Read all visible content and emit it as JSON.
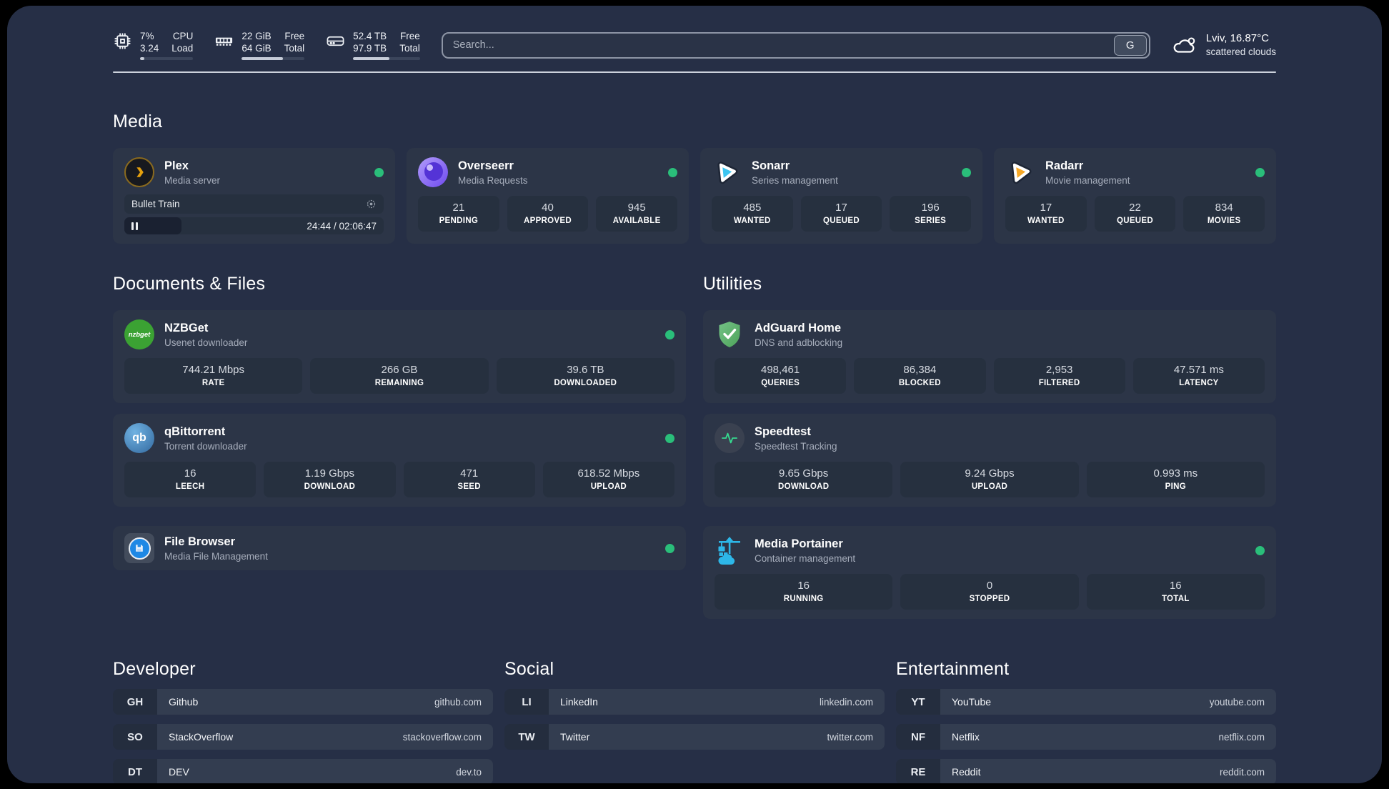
{
  "page": {
    "panel_bg": "#262f46",
    "card_bg": "#2c3547",
    "tile_bg": "#26303f",
    "accent_green": "#2abe7a"
  },
  "header": {
    "cpu": {
      "values": [
        "7%",
        "3.24"
      ],
      "labels": [
        "CPU",
        "Load"
      ],
      "progress_pct": 8
    },
    "memory": {
      "values": [
        "22 GiB",
        "64 GiB"
      ],
      "labels": [
        "Free",
        "Total"
      ],
      "progress_pct": 66
    },
    "disk": {
      "values": [
        "52.4 TB",
        "97.9 TB"
      ],
      "labels": [
        "Free",
        "Total"
      ],
      "progress_pct": 54
    },
    "search": {
      "placeholder": "Search...",
      "engine_button_label": "G"
    },
    "weather": {
      "location": "Lviv, 16.87°C",
      "condition": "scattered clouds"
    }
  },
  "media": {
    "title": "Media",
    "plex": {
      "name": "Plex",
      "description": "Media server",
      "online": true,
      "session": {
        "title": "Bullet Train",
        "time_display": "24:44 / 02:06:47",
        "progress_pct": 22
      }
    },
    "overseerr": {
      "name": "Overseerr",
      "description": "Media Requests",
      "online": true,
      "stats": [
        {
          "value": "21",
          "label": "PENDING"
        },
        {
          "value": "40",
          "label": "APPROVED"
        },
        {
          "value": "945",
          "label": "AVAILABLE"
        }
      ]
    },
    "sonarr": {
      "name": "Sonarr",
      "description": "Series management",
      "online": true,
      "stats": [
        {
          "value": "485",
          "label": "WANTED"
        },
        {
          "value": "17",
          "label": "QUEUED"
        },
        {
          "value": "196",
          "label": "SERIES"
        }
      ]
    },
    "radarr": {
      "name": "Radarr",
      "description": "Movie management",
      "online": true,
      "stats": [
        {
          "value": "17",
          "label": "WANTED"
        },
        {
          "value": "22",
          "label": "QUEUED"
        },
        {
          "value": "834",
          "label": "MOVIES"
        }
      ]
    }
  },
  "documents": {
    "title": "Documents & Files",
    "nzbget": {
      "name": "NZBGet",
      "description": "Usenet downloader",
      "online": true,
      "stats": [
        {
          "value": "744.21 Mbps",
          "label": "RATE"
        },
        {
          "value": "266 GB",
          "label": "REMAINING"
        },
        {
          "value": "39.6 TB",
          "label": "DOWNLOADED"
        }
      ]
    },
    "qbittorrent": {
      "name": "qBittorrent",
      "description": "Torrent downloader",
      "online": true,
      "stats": [
        {
          "value": "16",
          "label": "LEECH"
        },
        {
          "value": "1.19 Gbps",
          "label": "DOWNLOAD"
        },
        {
          "value": "471",
          "label": "SEED"
        },
        {
          "value": "618.52 Mbps",
          "label": "UPLOAD"
        }
      ]
    },
    "filebrowser": {
      "name": "File Browser",
      "description": "Media File Management",
      "online": true
    }
  },
  "utilities": {
    "title": "Utilities",
    "adguard": {
      "name": "AdGuard Home",
      "description": "DNS and adblocking",
      "stats": [
        {
          "value": "498,461",
          "label": "QUERIES"
        },
        {
          "value": "86,384",
          "label": "BLOCKED"
        },
        {
          "value": "2,953",
          "label": "FILTERED"
        },
        {
          "value": "47.571 ms",
          "label": "LATENCY"
        }
      ]
    },
    "speedtest": {
      "name": "Speedtest",
      "description": "Speedtest Tracking",
      "stats": [
        {
          "value": "9.65 Gbps",
          "label": "DOWNLOAD"
        },
        {
          "value": "9.24 Gbps",
          "label": "UPLOAD"
        },
        {
          "value": "0.993 ms",
          "label": "PING"
        }
      ]
    },
    "portainer": {
      "name": "Media Portainer",
      "description": "Container management",
      "online": true,
      "stats": [
        {
          "value": "16",
          "label": "RUNNING"
        },
        {
          "value": "0",
          "label": "STOPPED"
        },
        {
          "value": "16",
          "label": "TOTAL"
        }
      ]
    }
  },
  "bookmarks": {
    "developer": {
      "title": "Developer",
      "items": [
        {
          "abbr": "GH",
          "name": "Github",
          "domain": "github.com"
        },
        {
          "abbr": "SO",
          "name": "StackOverflow",
          "domain": "stackoverflow.com"
        },
        {
          "abbr": "DT",
          "name": "DEV",
          "domain": "dev.to"
        }
      ]
    },
    "social": {
      "title": "Social",
      "items": [
        {
          "abbr": "LI",
          "name": "LinkedIn",
          "domain": "linkedin.com"
        },
        {
          "abbr": "TW",
          "name": "Twitter",
          "domain": "twitter.com"
        }
      ]
    },
    "entertainment": {
      "title": "Entertainment",
      "items": [
        {
          "abbr": "YT",
          "name": "YouTube",
          "domain": "youtube.com"
        },
        {
          "abbr": "NF",
          "name": "Netflix",
          "domain": "netflix.com"
        },
        {
          "abbr": "RE",
          "name": "Reddit",
          "domain": "reddit.com"
        }
      ]
    }
  }
}
